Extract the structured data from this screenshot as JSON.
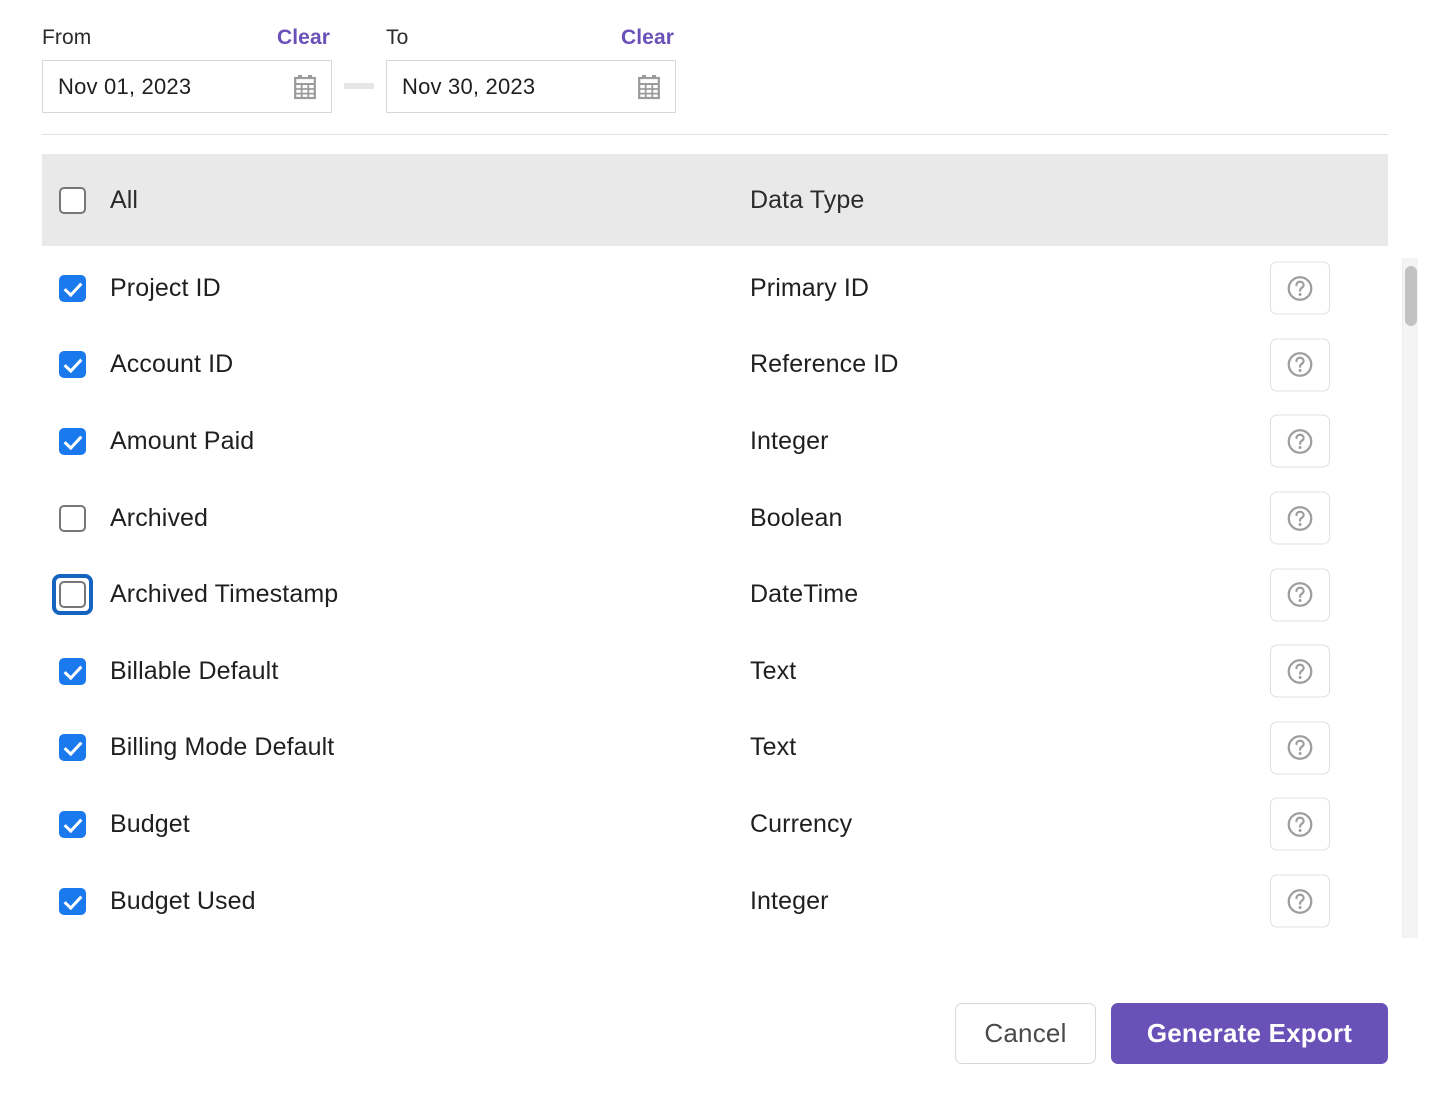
{
  "date_range": {
    "from": {
      "label": "From",
      "clear_label": "Clear",
      "value": "Nov 01, 2023",
      "icon": "calendar-icon"
    },
    "to": {
      "label": "To",
      "clear_label": "Clear",
      "value": "Nov 30, 2023",
      "icon": "calendar-icon"
    }
  },
  "table": {
    "header": {
      "select_all_label": "All",
      "select_all_checked": false,
      "data_type_label": "Data Type"
    },
    "rows": [
      {
        "name": "Project ID",
        "type": "Primary ID",
        "checked": true,
        "focused": false,
        "help_icon": "help-icon"
      },
      {
        "name": "Account ID",
        "type": "Reference ID",
        "checked": true,
        "focused": false,
        "help_icon": "help-icon"
      },
      {
        "name": "Amount Paid",
        "type": "Integer",
        "checked": true,
        "focused": false,
        "help_icon": "help-icon"
      },
      {
        "name": "Archived",
        "type": "Boolean",
        "checked": false,
        "focused": false,
        "help_icon": "help-icon"
      },
      {
        "name": "Archived Timestamp",
        "type": "DateTime",
        "checked": false,
        "focused": true,
        "help_icon": "help-icon"
      },
      {
        "name": "Billable Default",
        "type": "Text",
        "checked": true,
        "focused": false,
        "help_icon": "help-icon"
      },
      {
        "name": "Billing Mode Default",
        "type": "Text",
        "checked": true,
        "focused": false,
        "help_icon": "help-icon"
      },
      {
        "name": "Budget",
        "type": "Currency",
        "checked": true,
        "focused": false,
        "help_icon": "help-icon"
      },
      {
        "name": "Budget Used",
        "type": "Integer",
        "checked": true,
        "focused": false,
        "help_icon": "help-icon"
      }
    ]
  },
  "footer": {
    "cancel_label": "Cancel",
    "generate_label": "Generate Export"
  },
  "colors": {
    "accent_purple": "#6a51b8",
    "checkbox_blue": "#1a7aed",
    "focus_ring_blue": "#1565c0",
    "header_gray": "#e9e9e9"
  }
}
